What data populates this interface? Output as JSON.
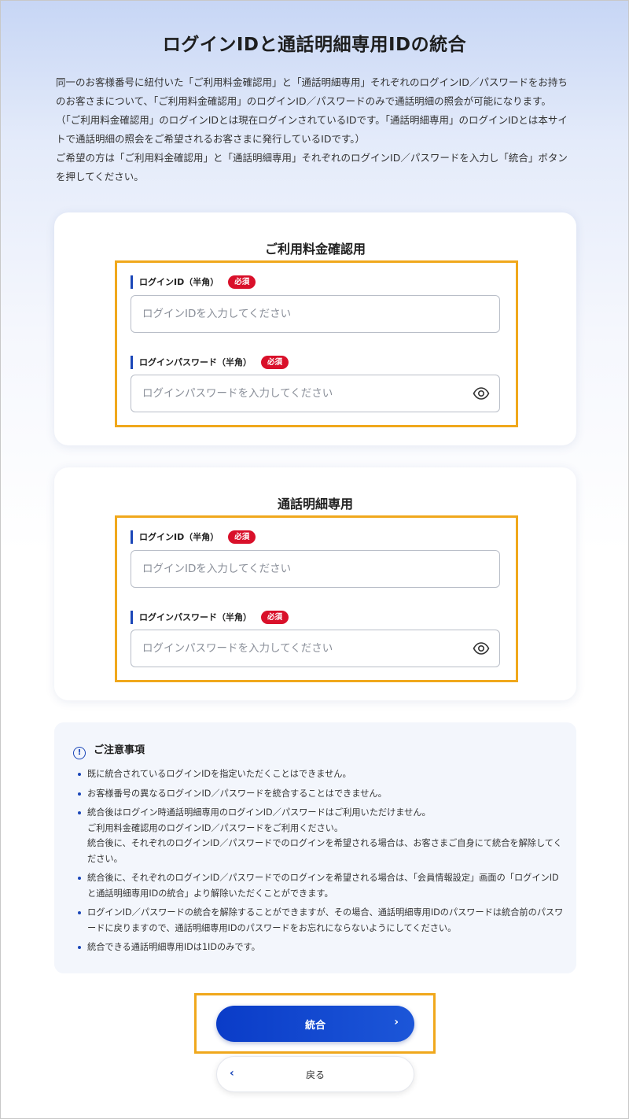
{
  "page": {
    "title": "ログインIDと通話明細専用IDの統合",
    "intro_p1": "同一のお客様番号に紐付いた「ご利用料金確認用」と「通話明細専用」それぞれのログインID／パスワードをお持ちのお客さまについて、「ご利用料金確認用」のログインID／パスワードのみで通話明細の照会が可能になります。 （「ご利用料金確認用」のログインIDとは現在ログインされているIDです。「通話明細専用」のログインIDとは本サイトで通話明細の照会をご希望されるお客さまに発行しているIDです。）",
    "intro_p2": "ご希望の方は「ご利用料金確認用」と「通話明細専用」それぞれのログインID／パスワードを入力し「統合」ボタンを押してください。"
  },
  "billing_card": {
    "title": "ご利用料金確認用",
    "login_id_label": "ログインID（半角）",
    "login_id_required": "必須",
    "login_id_placeholder": "ログインIDを入力してください",
    "password_label": "ログインパスワード（半角）",
    "password_required": "必須",
    "password_placeholder": "ログインパスワードを入力してください",
    "password_toggle_icon": "eye-icon"
  },
  "call_detail_card": {
    "title": "通話明細専用",
    "login_id_label": "ログインID（半角）",
    "login_id_required": "必須",
    "login_id_placeholder": "ログインIDを入力してください",
    "password_label": "ログインパスワード（半角）",
    "password_required": "必須",
    "password_placeholder": "ログインパスワードを入力してください",
    "password_toggle_icon": "eye-icon"
  },
  "notice": {
    "heading_icon": "info-icon",
    "heading": "ご注意事項",
    "items": [
      {
        "lines": [
          "既に統合されているログインIDを指定いただくことはできません。"
        ]
      },
      {
        "lines": [
          "お客様番号の異なるログインID／パスワードを統合することはできません。"
        ]
      },
      {
        "lines": [
          "統合後はログイン時通話明細専用のログインID／パスワードはご利用いただけません。",
          "ご利用料金確認用のログインID／パスワードをご利用ください。",
          "統合後に、それぞれのログインID／パスワードでのログインを希望される場合は、お客さまご自身にて統合を解除してください。"
        ]
      },
      {
        "lines": [
          "統合後に、それぞれのログインID／パスワードでのログインを希望される場合は、「会員情報設定」画面の「ログインIDと通話明細専用IDの統合」より解除いただくことができます。"
        ]
      },
      {
        "lines": [
          "ログインID／パスワードの統合を解除することができますが、その場合、通話明細専用IDのパスワードは統合前のパスワードに戻りますので、通話明細専用IDのパスワードをお忘れにならないようにしてください。"
        ]
      },
      {
        "lines": [
          "統合できる通話明細専用IDは1IDのみです。"
        ]
      }
    ]
  },
  "actions": {
    "submit_label": "統合",
    "submit_icon": "chevron-right-icon",
    "back_label": "戻る",
    "back_icon": "chevron-left-icon"
  },
  "colors": {
    "accent": "#1a46b8",
    "primary_button": "#0a3cc8",
    "required_badge": "#d9102a",
    "highlight_border": "#f0a81c"
  }
}
